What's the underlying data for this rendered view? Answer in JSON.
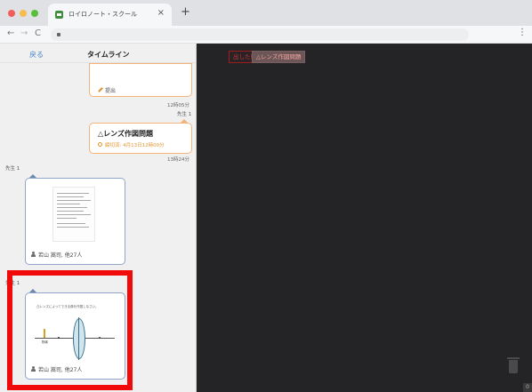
{
  "browser": {
    "tab_title": "ロイロノート・スクール",
    "close_glyph": "×",
    "new_tab_glyph": "+",
    "back_glyph": "←",
    "forward_glyph": "→",
    "reload_glyph": "C",
    "menu_glyph": "⋮"
  },
  "sidebar": {
    "back_label": "戻る",
    "title": "タイムライン",
    "cards": [
      {
        "label": "提出",
        "time": "12時05分"
      },
      {
        "sender": "先生 1",
        "title": "△レンズ作図問題",
        "deadline": "締切済: 4月13日12時00分",
        "time": "13時24分"
      },
      {
        "sender": "先生 1",
        "user": "若山 嵩司, 他27人"
      },
      {
        "sender": "先生 1",
        "user": "若山 嵩司, 他27人",
        "lens_caption": "凸レンズによってできる像を作図しなさい。",
        "object_label": "物体"
      }
    ]
  },
  "main": {
    "chip_submitted": "出した時間",
    "chip_lens": "△レンズ作図問題",
    "corner_glyph": "0"
  },
  "colors": {
    "highlight": "#f00a0a",
    "accent_orange": "#f4b37a",
    "main_bg": "#242326"
  }
}
